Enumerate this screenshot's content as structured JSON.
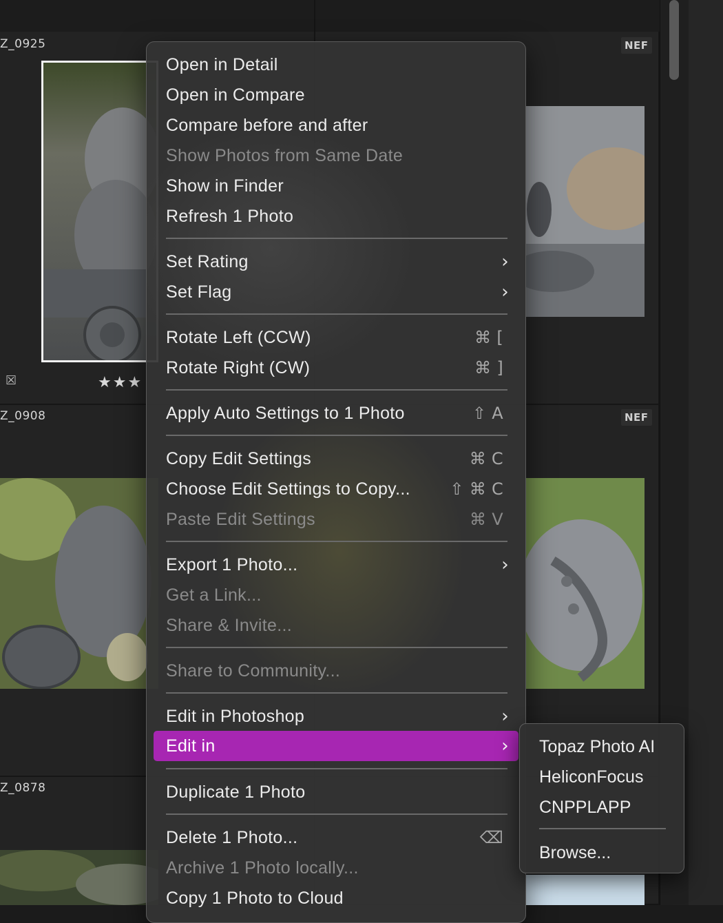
{
  "grid": {
    "row1": {
      "left_name": "Z_0925",
      "right_badge": "NEF",
      "stars": "★★★"
    },
    "row2": {
      "left_name": "Z_0908",
      "right_badge": "NEF"
    },
    "row3": {
      "left_name": "Z_0878"
    }
  },
  "icons": {
    "reject_flag": "☒"
  },
  "menu": {
    "items": [
      {
        "label": "Open in Detail",
        "shortcut": "",
        "submenu": false,
        "disabled": false
      },
      {
        "label": "Open in Compare",
        "shortcut": "",
        "submenu": false,
        "disabled": false
      },
      {
        "label": "Compare before and after",
        "shortcut": "",
        "submenu": false,
        "disabled": false
      },
      {
        "label": "Show Photos from Same Date",
        "shortcut": "",
        "submenu": false,
        "disabled": true
      },
      {
        "label": "Show in Finder",
        "shortcut": "",
        "submenu": false,
        "disabled": false
      },
      {
        "label": "Refresh 1 Photo",
        "shortcut": "",
        "submenu": false,
        "disabled": false
      },
      {
        "label": "Set Rating",
        "shortcut": "",
        "submenu": true,
        "disabled": false
      },
      {
        "label": "Set Flag",
        "shortcut": "",
        "submenu": true,
        "disabled": false
      },
      {
        "label": "Rotate Left (CCW)",
        "shortcut": "⌘ [",
        "submenu": false,
        "disabled": false
      },
      {
        "label": "Rotate Right (CW)",
        "shortcut": "⌘ ]",
        "submenu": false,
        "disabled": false
      },
      {
        "label": "Apply Auto Settings to 1 Photo",
        "shortcut": "⇧ A",
        "submenu": false,
        "disabled": false
      },
      {
        "label": "Copy Edit Settings",
        "shortcut": "⌘ C",
        "submenu": false,
        "disabled": false
      },
      {
        "label": "Choose Edit Settings to Copy...",
        "shortcut": "⇧ ⌘ C",
        "submenu": false,
        "disabled": false
      },
      {
        "label": "Paste Edit Settings",
        "shortcut": "⌘ V",
        "submenu": false,
        "disabled": true
      },
      {
        "label": "Export 1 Photo...",
        "shortcut": "",
        "submenu": true,
        "disabled": false
      },
      {
        "label": "Get a Link...",
        "shortcut": "",
        "submenu": false,
        "disabled": true
      },
      {
        "label": "Share & Invite...",
        "shortcut": "",
        "submenu": false,
        "disabled": true
      },
      {
        "label": "Share to Community...",
        "shortcut": "",
        "submenu": false,
        "disabled": true
      },
      {
        "label": "Edit in Photoshop",
        "shortcut": "",
        "submenu": true,
        "disabled": false
      },
      {
        "label": "Edit in",
        "shortcut": "",
        "submenu": true,
        "disabled": false,
        "active": true
      },
      {
        "label": "Duplicate 1 Photo",
        "shortcut": "",
        "submenu": false,
        "disabled": false
      },
      {
        "label": "Delete 1 Photo...",
        "shortcut": "⌫",
        "submenu": false,
        "disabled": false
      },
      {
        "label": "Archive 1 Photo locally...",
        "shortcut": "",
        "submenu": false,
        "disabled": true
      },
      {
        "label": "Copy 1 Photo to Cloud",
        "shortcut": "",
        "submenu": false,
        "disabled": false
      }
    ],
    "submenu_glyph": "›"
  },
  "edit_in_submenu": {
    "items": [
      {
        "label": "Topaz Photo AI"
      },
      {
        "label": "HeliconFocus"
      },
      {
        "label": "CNPPLAPP"
      },
      {
        "label": "Browse..."
      }
    ]
  },
  "colors": {
    "accent": "#a726b2",
    "menu_bg": "#343434",
    "grid_bg": "#212121"
  }
}
